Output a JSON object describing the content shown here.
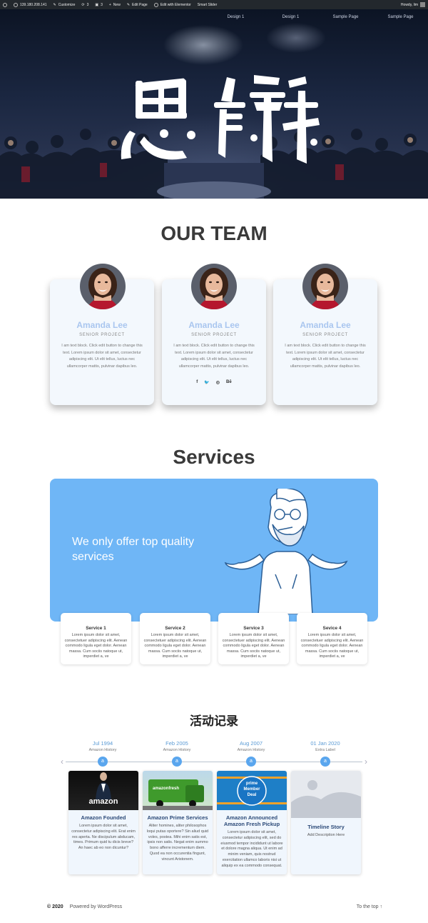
{
  "adminbar": {
    "site": "139.180.208.141",
    "customize": "Customize",
    "updates": "3",
    "comments": "3",
    "new": "New",
    "edit_page": "Edit Page",
    "edit_elementor": "Edit with Elementor",
    "smart_slider": "Smart Slider",
    "howdy": "Howdy, lim"
  },
  "hero": {
    "nav": [
      "Design 1",
      "Design 1",
      "Sample Page",
      "Sample Page"
    ],
    "calligraphy": "思辯"
  },
  "team": {
    "heading": "OUR TEAM",
    "members": [
      {
        "name": "Amanda Lee",
        "role": "SENIOR PROJECT",
        "bio": "I am text block. Click edit button to change this text. Lorem ipsum dolor sit amet, consectetur adipiscing elit. Ut elit tellus, luctus nec ullamcorper mattis, pulvinar dapibus leo."
      },
      {
        "name": "Amanda Lee",
        "role": "SENIOR PROJECT",
        "bio": "I am text block. Click edit button to change this text. Lorem ipsum dolor sit amet, consectetur adipiscing elit. Ut elit tellus, luctus nec ullamcorper mattis, pulvinar dapibus leo."
      },
      {
        "name": "Amanda Lee",
        "role": "SENIOR PROJECT",
        "bio": "I am text block. Click edit button to change this text. Lorem ipsum dolor sit amet, consectetur adipiscing elit. Ut elit tellus, luctus nec ullamcorper mattis, pulvinar dapibus leo."
      }
    ],
    "social": [
      "f",
      "🐦",
      "◎",
      "Bē"
    ]
  },
  "services": {
    "heading": "Services",
    "tagline": "We only offer top quality services",
    "items": [
      {
        "title": "Service 1",
        "desc": "Lorem ipsum dolor sit amet, consectetuer adipiscing elit. Aenean commodo ligula eget dolor. Aenean massa. Cum sociis natoque ut, imperdiet a, ve"
      },
      {
        "title": "Service 2",
        "desc": "Lorem ipsum dolor sit amet, consectetuer adipiscing elit. Aenean commodo ligula eget dolor. Aenean massa. Cum sociis natoque ut, imperdiet a, ve"
      },
      {
        "title": "Service 3",
        "desc": "Lorem ipsum dolor sit amet, consectetuer adipiscing elit. Aenean commodo ligula eget dolor. Aenean massa. Cum sociis natoque ut, imperdiet a, ve"
      },
      {
        "title": "Sevice 4",
        "desc": "Lorem ipsum dolor sit amet, consectetuer adipiscing elit. Aenean commodo ligula eget dolor. Aenean massa. Cum sociis natoque ut, imperdiet a, ve"
      }
    ]
  },
  "timeline": {
    "heading": "活动记录",
    "events": [
      {
        "date": "Jul 1994",
        "label": "Amazon History",
        "title": "Amazon Founded",
        "desc": "Lorem ipsum dolor sit amet, consectetur adipiscing elit. Erat enim res aperta. Ne discipulum abducam, times. Primum quid tu dicis breve? An haec ab eo non dicuntur?",
        "img_text": "amazon"
      },
      {
        "date": "Feb 2005",
        "label": "Amazon History",
        "title": "Amazon Prime Services",
        "desc": "Aliter homines, aliter philosophos loqui putas oportere? Sin aliud quid voles, postea. Mihi enim satis est, ipsis non satis. Negat enim summo bono afferre incrementum diem. Quod ea non occurentia fingunt, vincunt Aristonem.",
        "img_text": "amazonfresh"
      },
      {
        "date": "Aug 2007",
        "label": "Amazon History",
        "title": "Amazon Announced Amazon Fresh Pickup",
        "desc": "Lorem ipsum dolor sit amet, consectetur adipiscing elit, sed do eiusmod tempor incididunt ut labore et dolore magna aliqua. Ut enim ad minim veniam, quis nostrud exercitation ullamco laboris nisi ut aliquip ex ea commodo consequat.",
        "img_text": "prime Member Deal"
      },
      {
        "date": "01 Jan 2020",
        "label": "Extra Label",
        "title": "Timeline Story",
        "desc": "Add Description Here",
        "img_text": ""
      }
    ]
  },
  "footer": {
    "copyright": "© 2020",
    "powered": "Powered by WordPress",
    "to_top": "To the top ↑"
  },
  "colors": {
    "accent": "#6fb6f6",
    "name_blue": "#a9c6ef",
    "timeline_dot": "#5aa6ee",
    "dark": "#3a3a3a"
  },
  "icons": [
    "wordpress-icon",
    "brush-icon",
    "refresh-icon",
    "comment-icon",
    "plus-icon",
    "pencil-icon",
    "elementor-icon",
    "facebook-icon",
    "twitter-icon",
    "dribbble-icon",
    "behance-icon",
    "chevron-left-icon",
    "chevron-right-icon",
    "amazon-logo-icon"
  ]
}
